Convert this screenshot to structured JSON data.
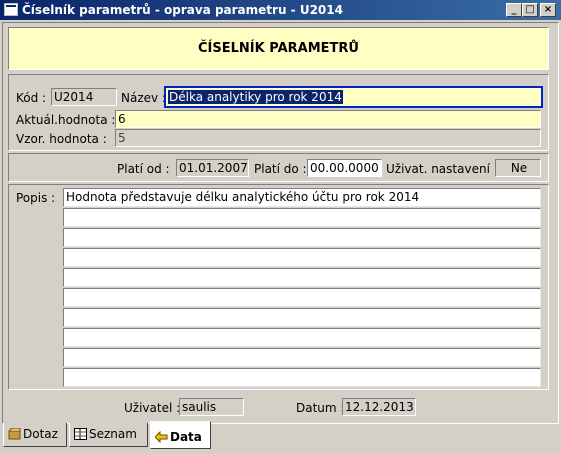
{
  "window": {
    "title": "Číselník parametrů - oprava parametru - U2014",
    "buttons": [
      "_",
      "□",
      "×"
    ]
  },
  "header": {
    "title": "ČÍSELNÍK PARAMETRŮ"
  },
  "form": {
    "kod_label": "Kód :",
    "kod_value": "U2014",
    "nazev_label": "Název :",
    "nazev_value": "Délka analytiky pro rok 2014",
    "aktual_label": "Aktuál.hodnota :",
    "aktual_value": "6",
    "vzor_label": "Vzor. hodnota :",
    "vzor_value": "5",
    "platnost_od_label": "Platí od :",
    "platnost_od_value": "01.01.2007",
    "platnost_do_label": "Platí do :",
    "platnost_do_value": "00.00.0000",
    "uzivat_nastaveni_label": "Uživat. nastavení :",
    "uzivat_nastaveni_value": "Ne"
  },
  "popis": {
    "label": "Popis :",
    "lines": [
      "Hodnota představuje délku analytického účtu pro rok 2014",
      "",
      "",
      "",
      "",
      "",
      "",
      "",
      "",
      ""
    ]
  },
  "footer": {
    "uzivatel_label": "Uživatel :",
    "uzivatel_value": "saulis",
    "datum_label": "Datum :",
    "datum_value": "12.12.2013"
  },
  "tabs": [
    {
      "label": "Dotaz",
      "icon": "box-icon",
      "active": false
    },
    {
      "label": "Seznam",
      "icon": "list-icon",
      "active": false
    },
    {
      "label": "Data",
      "icon": "arrow-left-icon",
      "active": true
    }
  ]
}
